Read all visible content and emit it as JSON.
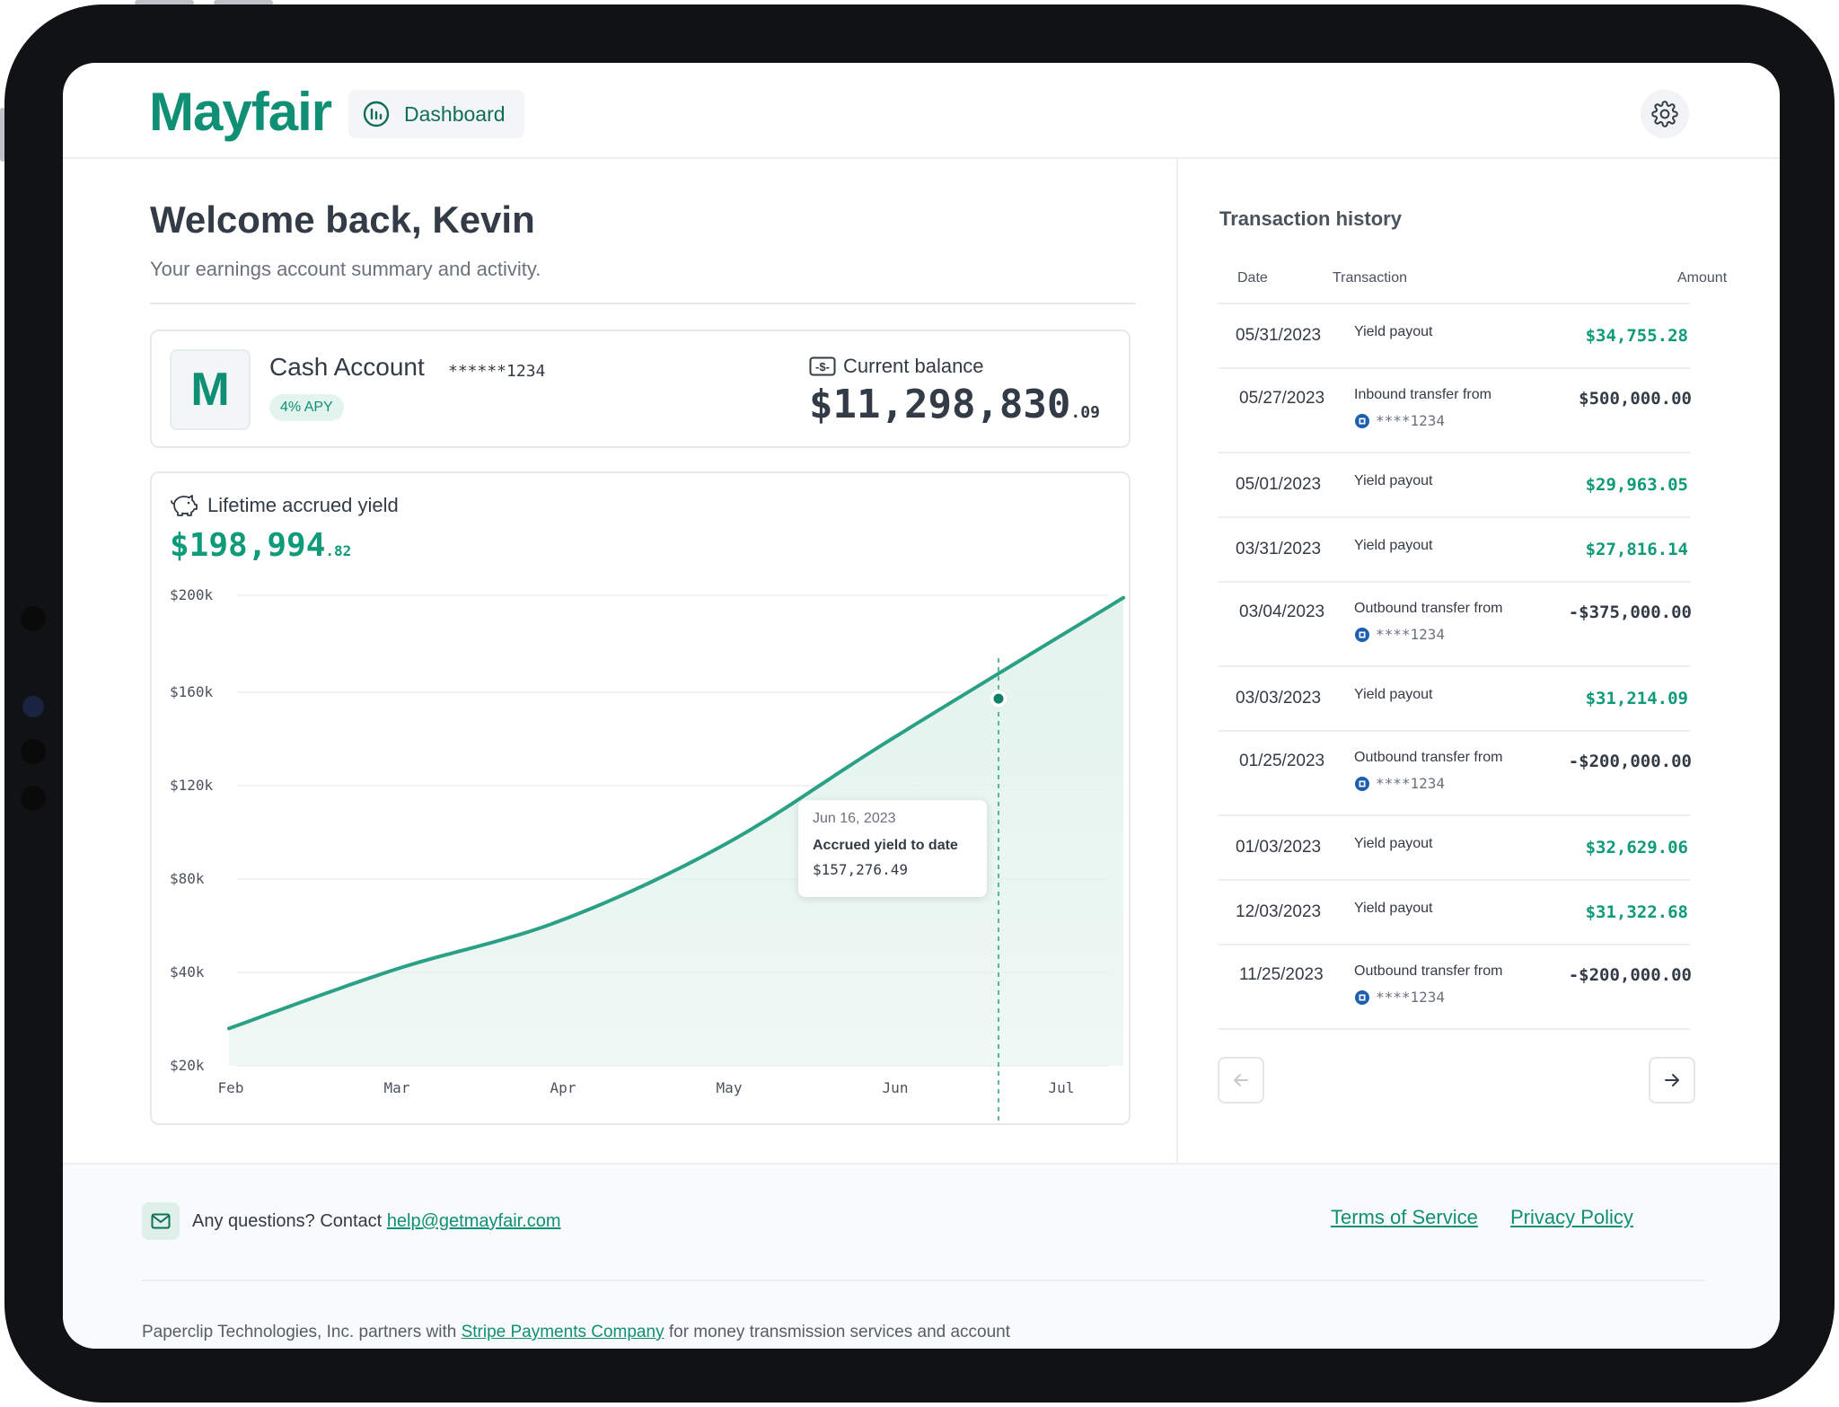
{
  "header": {
    "logo": "Mayfair",
    "nav_label": "Dashboard",
    "settings_icon": "gear-icon"
  },
  "welcome": {
    "title": "Welcome back, Kevin",
    "subtitle": "Your earnings account summary and activity."
  },
  "account": {
    "avatar_letter": "M",
    "name": "Cash Account",
    "masked_number": "******1234",
    "apy": "4% APY",
    "balance_label": "Current balance",
    "balance_main": "$11,298,830",
    "balance_cents": ".09"
  },
  "yield": {
    "label": "Lifetime accrued yield",
    "value_main": "$198,994",
    "value_cents": ".82",
    "tooltip": {
      "date": "Jun 16, 2023",
      "label": "Accrued yield to date",
      "value": "$157,276.49"
    }
  },
  "chart_data": {
    "type": "area",
    "title": "",
    "xlabel": "",
    "ylabel": "",
    "x_ticks": [
      "Feb",
      "Mar",
      "Apr",
      "May",
      "Jun",
      "Jul"
    ],
    "y_ticks": [
      "$20k",
      "$40k",
      "$80k",
      "$120k",
      "$160k",
      "$200k"
    ],
    "ylim": [
      20000,
      200000
    ],
    "x": [
      "Feb",
      "Mar",
      "Apr",
      "May",
      "Jun",
      "Jul"
    ],
    "values": [
      28000,
      41000,
      62000,
      95000,
      140000,
      198994
    ],
    "highlight": {
      "x": "Jun 16",
      "value": 157276.49
    },
    "grid": true,
    "colors": {
      "line": "#2aa084",
      "fill": "#e3f3ee"
    }
  },
  "transactions": {
    "title": "Transaction history",
    "columns": [
      "Date",
      "Transaction",
      "Amount"
    ],
    "rows": [
      {
        "date": "05/31/2023",
        "desc": "Yield payout",
        "sub": "",
        "amount": "$34,755.28",
        "positive": true
      },
      {
        "date": "05/27/2023",
        "desc": "Inbound transfer from",
        "sub": "****1234",
        "amount": "$500,000.00",
        "positive": false
      },
      {
        "date": "05/01/2023",
        "desc": "Yield payout",
        "sub": "",
        "amount": "$29,963.05",
        "positive": true
      },
      {
        "date": "03/31/2023",
        "desc": "Yield payout",
        "sub": "",
        "amount": "$27,816.14",
        "positive": true
      },
      {
        "date": "03/04/2023",
        "desc": "Outbound transfer from",
        "sub": "****1234",
        "amount": "-$375,000.00",
        "positive": false
      },
      {
        "date": "03/03/2023",
        "desc": "Yield payout",
        "sub": "",
        "amount": "$31,214.09",
        "positive": true
      },
      {
        "date": "01/25/2023",
        "desc": "Outbound transfer from",
        "sub": "****1234",
        "amount": "-$200,000.00",
        "positive": false
      },
      {
        "date": "01/03/2023",
        "desc": "Yield payout",
        "sub": "",
        "amount": "$32,629.06",
        "positive": true
      },
      {
        "date": "12/03/2023",
        "desc": "Yield payout",
        "sub": "",
        "amount": "$31,322.68",
        "positive": true
      },
      {
        "date": "11/25/2023",
        "desc": "Outbound transfer from",
        "sub": "****1234",
        "amount": "-$200,000.00",
        "positive": false
      }
    ]
  },
  "footer": {
    "contact_prefix": "Any questions? Contact",
    "contact_email": "help@getmayfair.com",
    "terms": "Terms of Service",
    "privacy": "Privacy Policy",
    "legal_prefix": "Paperclip Technologies, Inc. partners with",
    "legal_link": "Stripe Payments Company",
    "legal_suffix": "for money transmission services and account"
  },
  "colors": {
    "brand": "#0f8f74",
    "positive": "#0f9a7a",
    "text": "#333b46"
  }
}
